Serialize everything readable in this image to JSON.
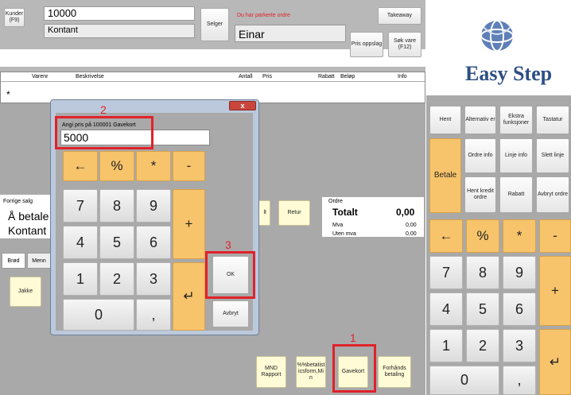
{
  "top": {
    "customer_btn": "Kunder (F9)",
    "customer_no": "10000",
    "customer_name": "Kontant",
    "seller_btn": "Selger",
    "parked_text": "Du har parkerte ordre",
    "seller_name": "Einar",
    "takeaway": "Takeaway",
    "price_lookup": "Pris oppslag",
    "search_item": "Søk vare (F12)"
  },
  "table": {
    "headers": [
      "Varenr",
      "Beskrivelse",
      "Antall",
      "Pris",
      "Rabatt",
      "Beløp",
      "Info"
    ],
    "row_marker": "*"
  },
  "logo": "Easy Step",
  "dialog": {
    "label": "Angi pris på 100001 Gavekort",
    "value": "5000",
    "ok": "OK",
    "cancel": "Avbryt",
    "close": "x",
    "keys": {
      "back": "←",
      "pct": "%",
      "star": "*",
      "minus": "-",
      "plus": "+",
      "comma": ",",
      "enter": "↵",
      "n7": "7",
      "n8": "8",
      "n9": "9",
      "n4": "4",
      "n5": "5",
      "n6": "6",
      "n1": "1",
      "n2": "2",
      "n3": "3",
      "n0": "0"
    }
  },
  "left": {
    "prev_sale": "Forrige salg",
    "to_pay": "Å betale",
    "payment": "Kontant",
    "tabs": [
      "Brød",
      "Menn"
    ],
    "item_jakke": "Jakke"
  },
  "mid": {
    "retur": "Retur",
    "partial_btn": "lt"
  },
  "order": {
    "title": "Ordre",
    "total_label": "Totalt",
    "total_value": "0,00",
    "mva_label": "Mva",
    "mva_value": "0,00",
    "uten_label": "Uten mva",
    "uten_value": "0,00"
  },
  "bottom": {
    "mnd": "MND Rapport",
    "stat": "%%betatist icsform,Mi n",
    "gavekort": "Gavekort",
    "forhand": "Forhånds betaling"
  },
  "right": {
    "hent": "Hent",
    "alternativer": "Alternativ er",
    "ekstra": "Ekstra funksjoner",
    "tastatur": "Tastatur",
    "betale": "Betale",
    "ordre_info": "Ordre info",
    "linje_info": "Linje info",
    "slett_linje": "Slett linje",
    "hent_kreditt": "Hent kredit ordre",
    "rabatt": "Rabatt",
    "avbryt_ordre": "Avbryt ordre",
    "keys": {
      "back": "←",
      "pct": "%",
      "star": "*",
      "minus": "-",
      "plus": "+",
      "comma": ",",
      "enter": "↵",
      "n7": "7",
      "n8": "8",
      "n9": "9",
      "n4": "4",
      "n5": "5",
      "n6": "6",
      "n1": "1",
      "n2": "2",
      "n3": "3",
      "n0": "0"
    }
  },
  "annotations": {
    "a1": "1",
    "a2": "2",
    "a3": "3"
  },
  "colors": {
    "orange": "#f7c46b",
    "highlight": "#e0222b",
    "panel": "#a9a9a9"
  },
  "icons": [
    "globe-logo-icon",
    "close-icon",
    "enter-icon",
    "back-arrow-icon"
  ]
}
